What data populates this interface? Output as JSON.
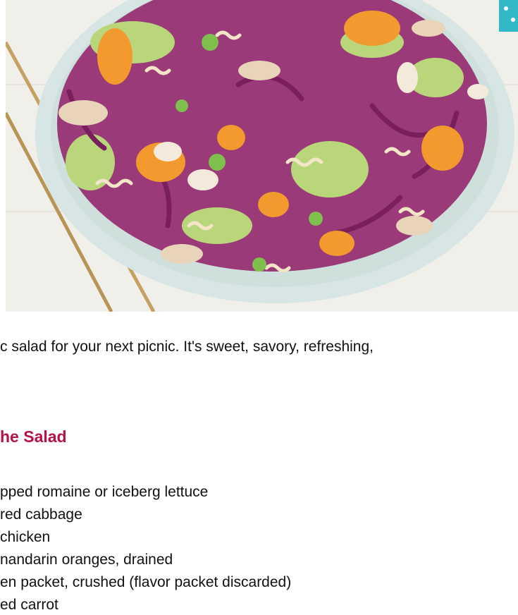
{
  "photo": {
    "subject": "salad-bowl-photo",
    "colors": {
      "background": "#f3f1ee",
      "bowl": "#d7e6e4",
      "cabbage": "#8a2a6b",
      "orange": "#f29a2e",
      "lettuce": "#b9d77a",
      "noodle": "#f3e6c8",
      "green_onion": "#7fbf4e",
      "chopstick": "#b79555"
    }
  },
  "intro_text": "c salad for your next picnic. It's sweet, savory, refreshing,",
  "section_heading": "he Salad",
  "ingredients": [
    "pped romaine or iceberg lettuce",
    " red cabbage",
    " chicken",
    "nandarin oranges, drained",
    "en packet, crushed (flavor packet discarded)",
    "ed carrot"
  ]
}
